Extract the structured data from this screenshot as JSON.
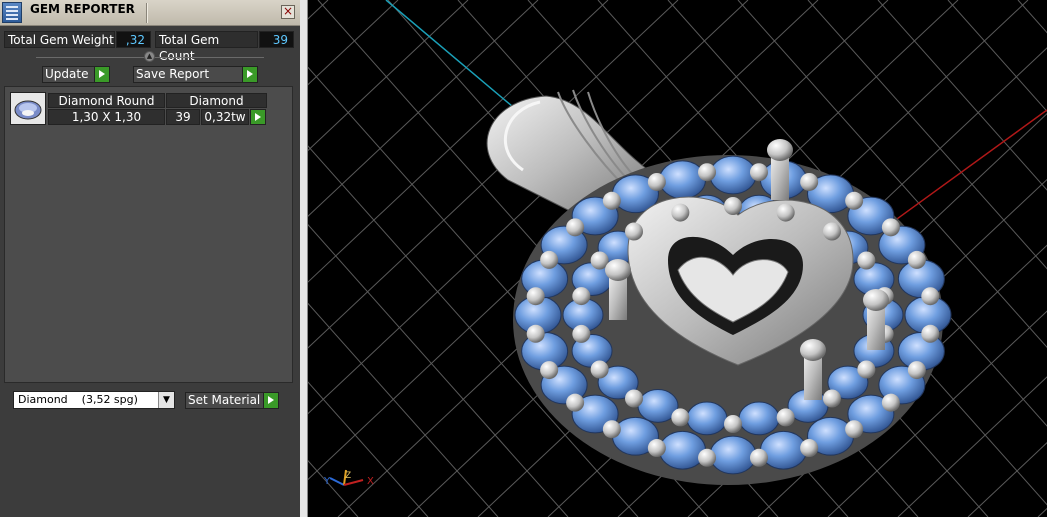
{
  "window": {
    "title": "GEM REPORTER",
    "close_icon": "close-icon"
  },
  "stats": {
    "weight_label": "Total Gem Weight",
    "weight_value": ",32",
    "count_label": "Total Gem Count",
    "count_value": "39"
  },
  "toolbar": {
    "update_label": "Update",
    "save_report_label": "Save Report"
  },
  "gem_table": {
    "headers": [
      "Diamond Round",
      "Diamond"
    ],
    "rows": [
      {
        "size": "1,30 X 1,30",
        "count": "39",
        "weight": "0,32tw"
      }
    ]
  },
  "material": {
    "selected": "Diamond    (3,52 spg)",
    "set_label": "Set Material"
  },
  "viewport": {
    "axis_labels": {
      "y": "Y",
      "z": "Z",
      "x": "X"
    },
    "colors": {
      "gem": "#6f9ee0",
      "metal": "#d4d4d4",
      "grid": "#5a5a5a",
      "axis_x": "#b01818",
      "axis_y": "#1aa0b8"
    }
  }
}
